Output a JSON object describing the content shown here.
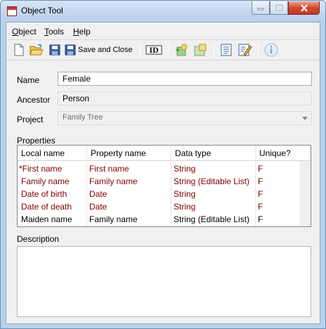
{
  "window": {
    "title": "Object Tool"
  },
  "menu": [
    {
      "label": "Object",
      "mnemonic": "O"
    },
    {
      "label": "Tools",
      "mnemonic": "T"
    },
    {
      "label": "Help",
      "mnemonic": "H"
    }
  ],
  "toolbar": {
    "save_close_label": "Save and Close",
    "id_label": "ID"
  },
  "form": {
    "name_label": "Name",
    "name_value": "Female",
    "ancestor_label": "Ancestor",
    "ancestor_value": "Person",
    "project_label": "Project",
    "project_value": "Family Tree"
  },
  "properties": {
    "label": "Properties",
    "columns": [
      "Local name",
      "Property name",
      "Data type",
      "Unique?"
    ],
    "rows": [
      {
        "cells": [
          "*First name",
          "First name",
          "String",
          "F"
        ],
        "color": "#7f0000"
      },
      {
        "cells": [
          "Family name",
          "Family name",
          "String (Editable List)",
          "F"
        ],
        "color": "#7f0000"
      },
      {
        "cells": [
          "Date of birth",
          "Date",
          "String",
          "F"
        ],
        "color": "#7f0000"
      },
      {
        "cells": [
          "Date of death",
          "Date",
          "String",
          "F"
        ],
        "color": "#7f0000"
      },
      {
        "cells": [
          "Maiden name",
          "Family name",
          "String (Editable List)",
          "F"
        ],
        "color": "#000000"
      }
    ]
  },
  "description": {
    "label": "Description",
    "value": ""
  }
}
